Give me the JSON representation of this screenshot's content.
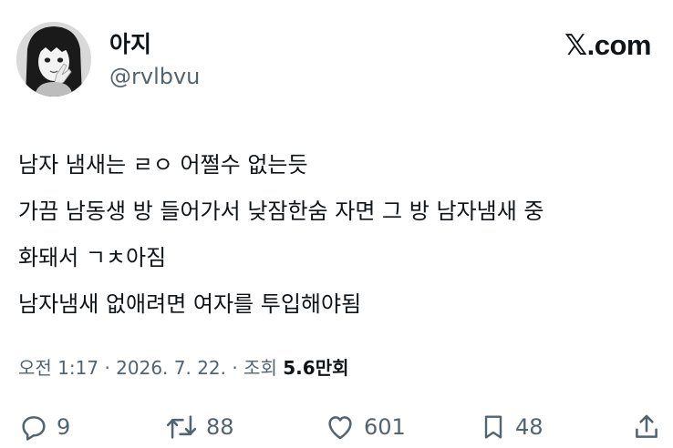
{
  "author": {
    "display_name": "아지",
    "handle": "@rvlbvu"
  },
  "brand": "𝕏.com",
  "tweet": {
    "lines": [
      "남자 냄새는 ㄹㅇ 어쩔수 없는듯",
      "가끔 남동생 방 들어가서 낮잠한숨 자면 그 방 남자냄새 중",
      "화돼서 ㄱㅊ아짐",
      "남자냄새 없애려면 여자를 투입해야됨"
    ]
  },
  "meta": {
    "time": "오전 1:17",
    "sep1": "·",
    "date": "2026. 7. 22.",
    "sep2": "·",
    "views_label": "조회",
    "views_count": "5.6만회"
  },
  "actions": {
    "replies": "9",
    "reposts": "88",
    "likes": "601",
    "bookmarks": "48"
  },
  "icons": [
    "avatar",
    "reply-icon",
    "repost-icon",
    "like-icon",
    "bookmark-icon",
    "share-icon"
  ],
  "colors": {
    "text": "#0f1419",
    "muted": "#536471",
    "background": "#ffffff"
  }
}
